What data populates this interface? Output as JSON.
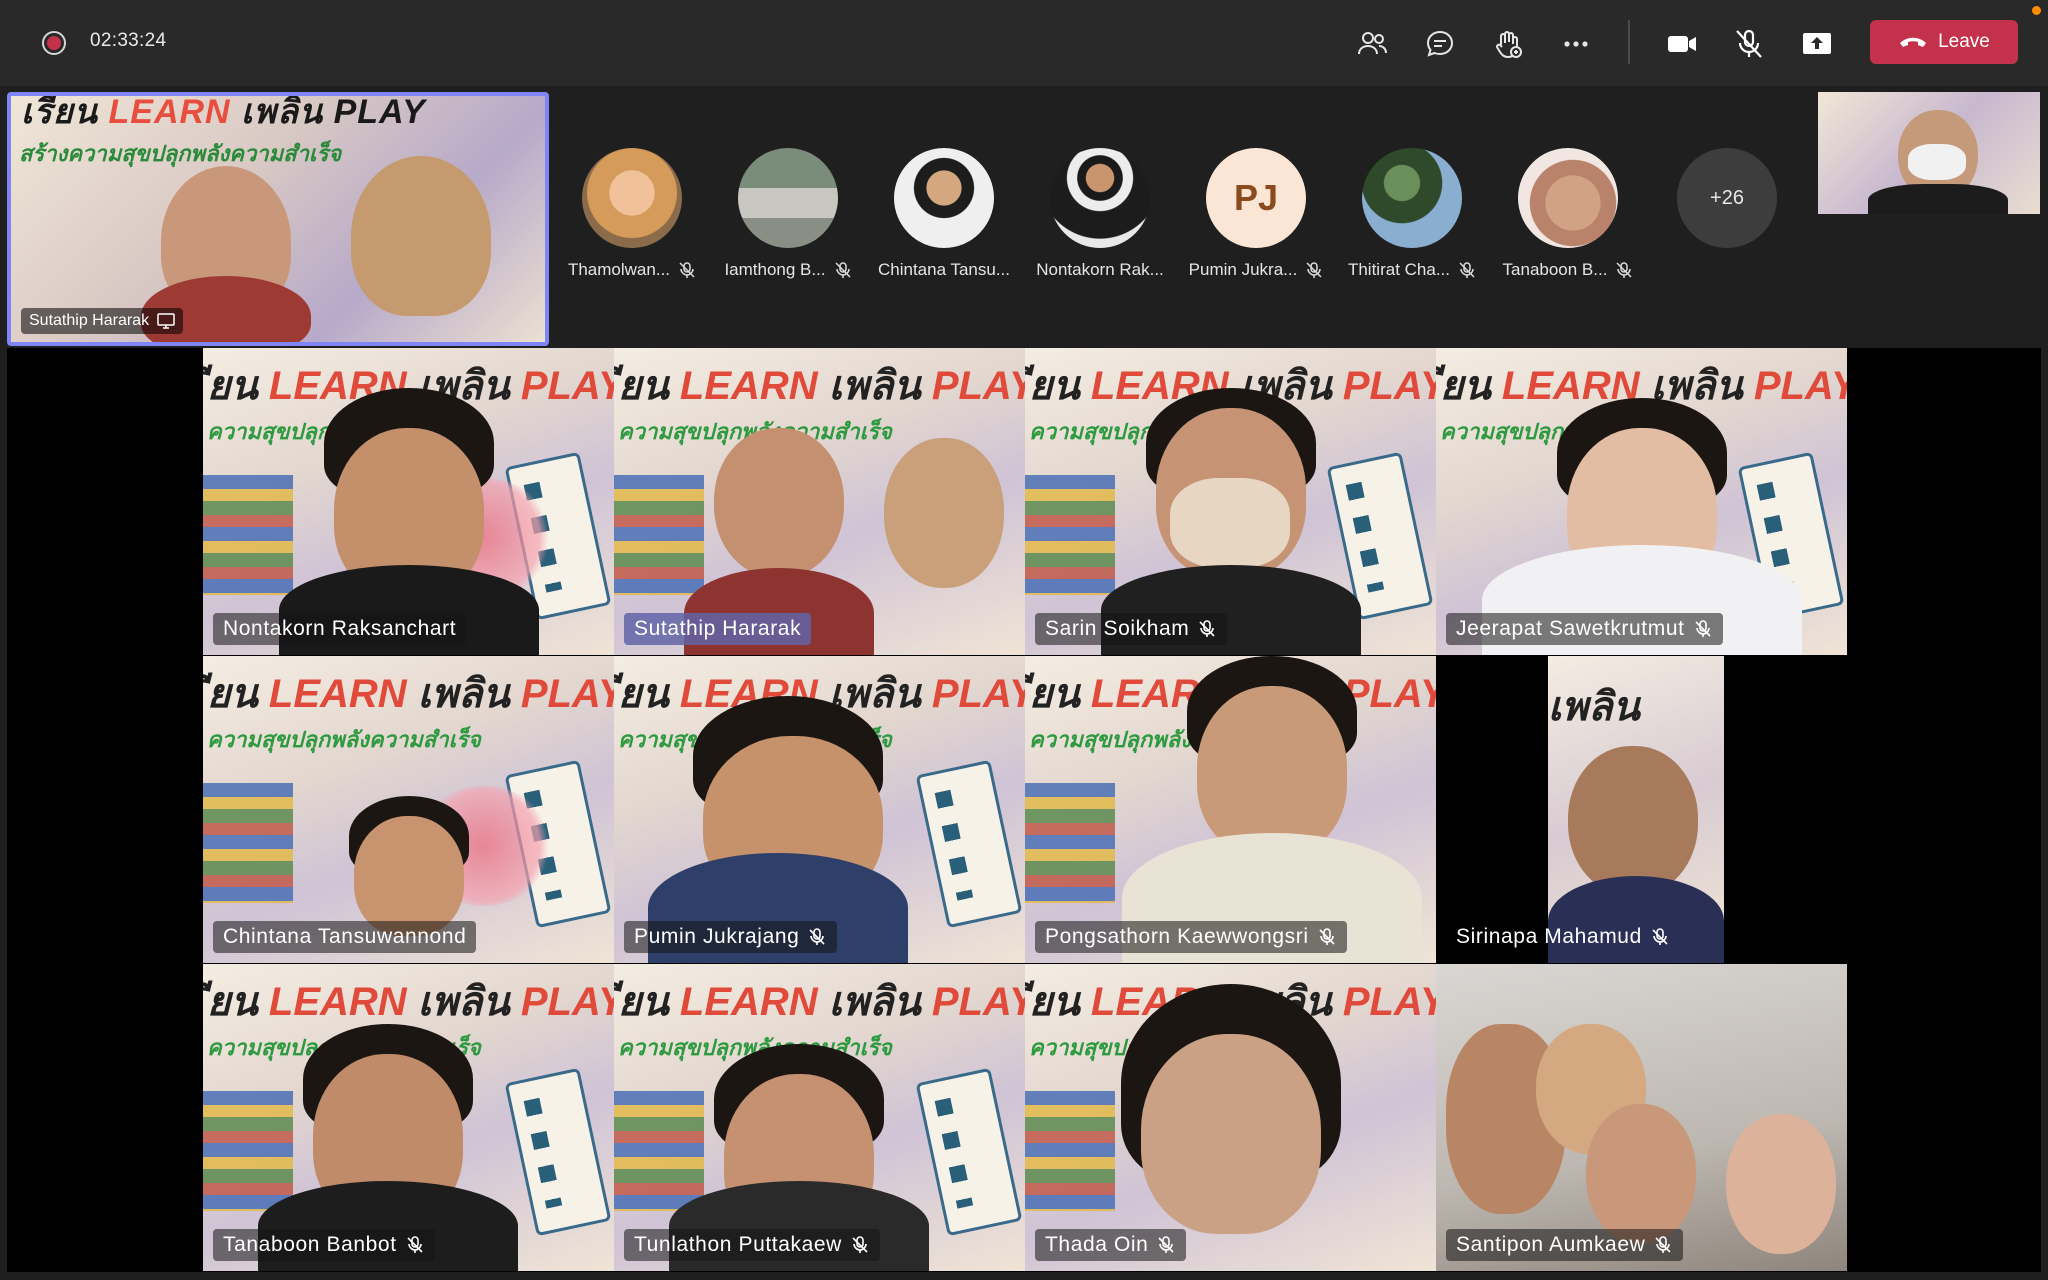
{
  "toolbar": {
    "timer": "02:33:24",
    "leave_label": "Leave"
  },
  "spotlight": {
    "name": "Sutathip Hararak",
    "banner_a": "เรียน ",
    "banner_b": "LEARN",
    "banner_c": " เพลิน PLAY",
    "subline": "สร้างความสุขปลุกพลังความสำเร็จ"
  },
  "participants_row": [
    {
      "name": "Thamolwan...",
      "muted": true
    },
    {
      "name": "Iamthong B...",
      "muted": true
    },
    {
      "name": "Chintana Tansu...",
      "muted": false
    },
    {
      "name": "Nontakorn Rak...",
      "muted": false
    },
    {
      "name": "Pumin Jukra...",
      "muted": true,
      "initials": "PJ"
    },
    {
      "name": "Thitirat Cha...",
      "muted": true
    },
    {
      "name": "Tanaboon B...",
      "muted": true
    }
  ],
  "more_count": "+26",
  "grid_banner": {
    "a": "ียน ",
    "b": "LEARN",
    "c": " เพลิน ",
    "d": "PLAY",
    "subline": "ความสุขปลุกพลังความสำเร็จ"
  },
  "grid": [
    {
      "name": "Nontakorn Raksanchart",
      "muted": false,
      "active": false
    },
    {
      "name": "Sutathip Hararak",
      "muted": false,
      "active": true
    },
    {
      "name": "Sarin Soikham",
      "muted": true,
      "active": false
    },
    {
      "name": "Jeerapat Sawetkrutmut",
      "muted": true,
      "active": false
    },
    {
      "name": "Chintana Tansuwannond",
      "muted": false,
      "active": false
    },
    {
      "name": "Pumin Jukrajang",
      "muted": true,
      "active": false
    },
    {
      "name": "Pongsathorn Kaewwongsri",
      "muted": true,
      "active": false
    },
    {
      "name": "Sirinapa Mahamud",
      "muted": true,
      "active": false
    },
    {
      "name": "Tanaboon Banbot",
      "muted": true,
      "active": false
    },
    {
      "name": "Tunlathon Puttakaew",
      "muted": true,
      "active": false
    },
    {
      "name": "Thada Oin",
      "muted": true,
      "active": false
    },
    {
      "name": "Santipon Aumkaew",
      "muted": true,
      "active": false
    }
  ],
  "colors": {
    "leave": "#c4314b",
    "active_border": "#7f85f5",
    "recording": "#c4314b"
  }
}
